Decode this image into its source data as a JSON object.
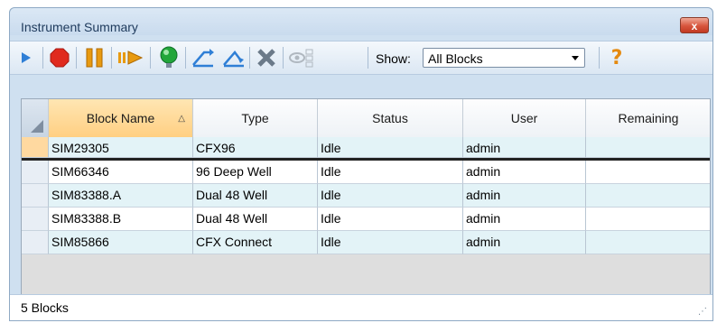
{
  "window": {
    "title": "Instrument Summary",
    "close_label": "x"
  },
  "toolbar": {
    "show_label": "Show:",
    "show_value": "All Blocks",
    "help_glyph": "?",
    "buttons": [
      {
        "icon": "play-icon",
        "color": "#2f7fd6"
      },
      {
        "icon": "stop-icon",
        "color": "#e02a1e"
      },
      {
        "icon": "pause-icon",
        "color": "#e89a10"
      },
      {
        "icon": "skip-forward-icon",
        "color": "#e89a10"
      },
      {
        "icon": "led-icon",
        "color": "#22a63a"
      },
      {
        "icon": "open-lid-icon",
        "color": "#2f7fd6"
      },
      {
        "icon": "close-lid-icon",
        "color": "#2f7fd6"
      },
      {
        "icon": "delete-icon",
        "color": "#6b7a89"
      },
      {
        "icon": "view-icon",
        "color": "#b0b8c0"
      },
      {
        "icon": "help-icon",
        "color": "#e58a10"
      }
    ]
  },
  "table": {
    "columns": [
      "Block Name",
      "Type",
      "Status",
      "User",
      "Remaining"
    ],
    "rows": [
      [
        "SIM29305",
        "CFX96",
        "Idle",
        "admin",
        ""
      ],
      [
        "SIM66346",
        "96 Deep Well",
        "Idle",
        "admin",
        ""
      ],
      [
        "SIM83388.A",
        "Dual 48 Well",
        "Idle",
        "admin",
        ""
      ],
      [
        "SIM83388.B",
        "Dual 48 Well",
        "Idle",
        "admin",
        ""
      ],
      [
        "SIM85866",
        "CFX Connect",
        "Idle",
        "admin",
        ""
      ]
    ]
  },
  "status": {
    "text": "5 Blocks"
  }
}
